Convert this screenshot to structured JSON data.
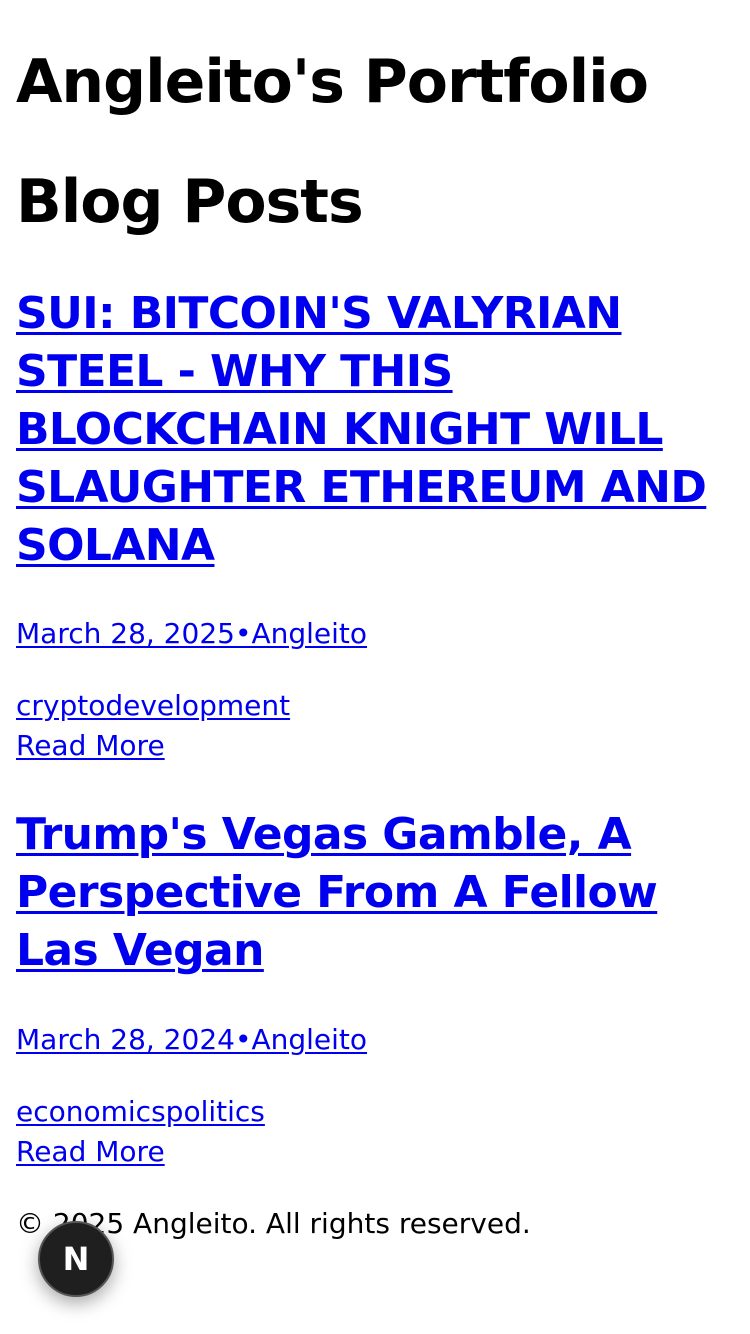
{
  "site": {
    "title": "Angleito's Portfolio"
  },
  "section": {
    "title": "Blog Posts"
  },
  "posts": [
    {
      "title": "SUI: BITCOIN'S VALYRIAN STEEL - WHY THIS BLOCKCHAIN KNIGHT WILL SLAUGHTER ETHEREUM AND SOLANA",
      "meta": "March 28, 2025•Angleito",
      "tags": "cryptodevelopment",
      "read_more": "Read More"
    },
    {
      "title": "Trump's Vegas Gamble, A Perspective From A Fellow Las Vegan",
      "meta": "March 28, 2024•Angleito",
      "tags": "economicspolitics",
      "read_more": "Read More"
    }
  ],
  "footer": {
    "text": "© 2025 Angleito. All rights reserved."
  },
  "dev_indicator": {
    "label": "N",
    "icon": "nextjs-dev-indicator-icon"
  },
  "colors": {
    "link": "#0000ee",
    "text": "#000000",
    "background": "#ffffff",
    "indicator": "#1f1f1f"
  }
}
